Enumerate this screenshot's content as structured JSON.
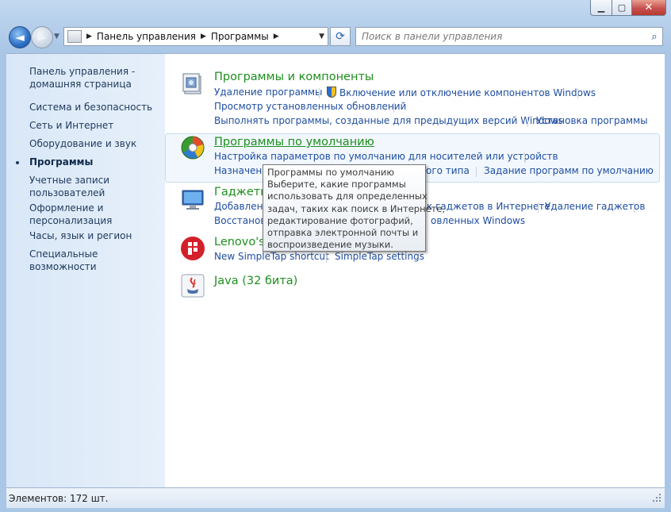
{
  "window_buttons": {
    "minimize": "▁",
    "maximize": "▢",
    "close": "✕"
  },
  "nav": {
    "back_glyph": "◄",
    "forward_glyph": "►",
    "breadcrumb": [
      "Панель управления",
      "Программы"
    ],
    "search_placeholder": "Поиск в панели управления"
  },
  "sidebar": {
    "home": "Панель управления - домашняя страница",
    "items": [
      "Система и безопасность",
      "Сеть и Интернет",
      "Оборудование и звук",
      "Программы",
      "Учетные записи пользователей",
      "Оформление и персонализация",
      "Часы, язык и регион",
      "Специальные возможности"
    ]
  },
  "categories": {
    "programs": {
      "title": "Программы и компоненты",
      "links": [
        "Удаление программы",
        "Включение или отключение компонентов Windows",
        "Просмотр установленных обновлений",
        "Выполнять программы, созданные для предыдущих версий Windows",
        "Установка программы"
      ]
    },
    "defaults": {
      "title": "Программы по умолчанию",
      "links": [
        "Настройка параметров по умолчанию для носителей или устройств",
        "Назначение",
        "ого типа",
        "Задание программ по умолчанию"
      ]
    },
    "gadgets": {
      "title": "Гаджеты",
      "links": [
        "Добавлени",
        "к гаджетов в Интернете",
        "Удаление гаджетов",
        "Восстанов",
        "овленных Windows"
      ]
    },
    "lenovo": {
      "title": "Lenovo's",
      "links": [
        "New SimpleTap shortcut",
        "SimpleTap settings"
      ]
    },
    "java": {
      "title": "Java (32 бита)"
    }
  },
  "tooltip": {
    "lines": [
      "Программы по умолчанию",
      "Выберите, какие программы",
      "использовать для определенных",
      "задач, таких как поиск в Интернете,",
      "редактирование фотографий,",
      "отправка электронной почты и",
      "воспроизведение музыки."
    ]
  },
  "status": {
    "items_count": "Элементов: 172 шт."
  },
  "colors": {
    "title_green": "#1d8f1d",
    "link_blue": "#1f4ea0",
    "sidebar_bg": "#dde9f7"
  }
}
